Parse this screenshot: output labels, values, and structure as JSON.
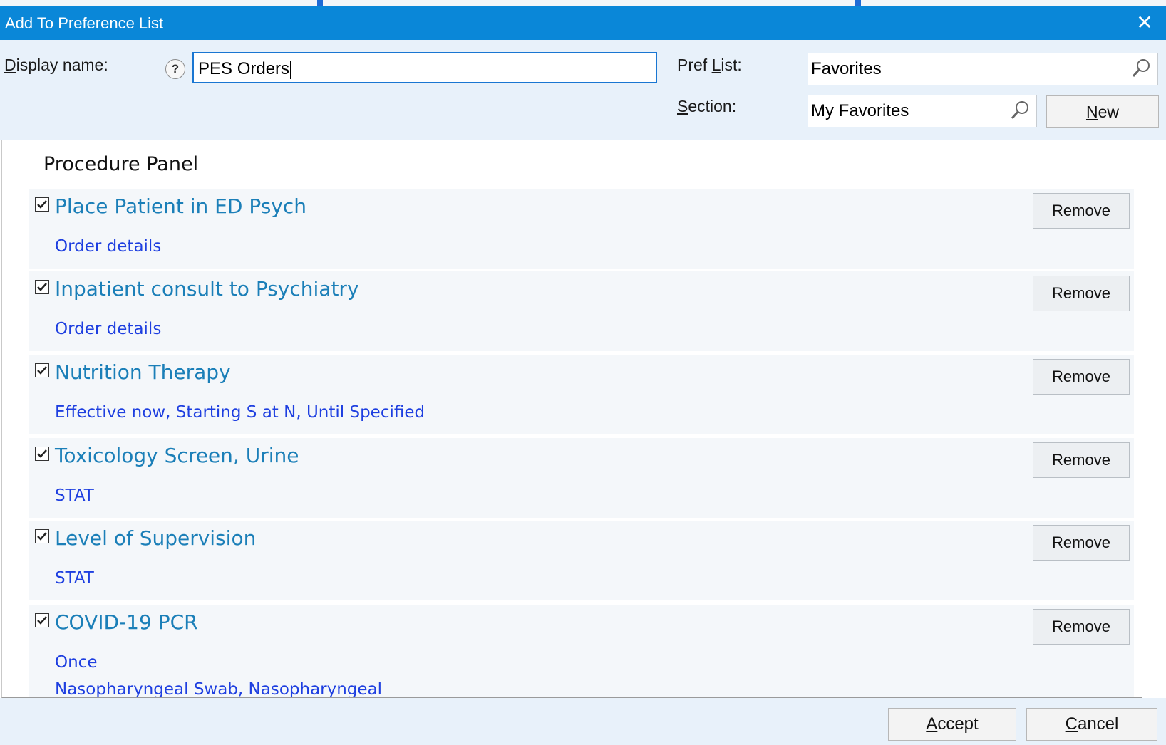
{
  "dialog": {
    "title": "Add To Preference List"
  },
  "header": {
    "display_name_label_pre": "D",
    "display_name_label_post": "isplay name:",
    "display_name_value": "PES Orders",
    "help_glyph": "?",
    "pref_list_label_pre": "Pref ",
    "pref_list_label_u": "L",
    "pref_list_label_post": "ist:",
    "pref_list_value": "Favorites",
    "section_label_u": "S",
    "section_label_post": "ection:",
    "section_value": "My Favorites",
    "new_button_u": "N",
    "new_button_post": "ew"
  },
  "list": {
    "heading": "Procedure Panel",
    "remove_label": "Remove",
    "items": [
      {
        "name": "Place Patient in ED Psych",
        "detail": "Order details",
        "checked": true
      },
      {
        "name": "Inpatient consult to Psychiatry",
        "detail": "Order details",
        "checked": true
      },
      {
        "name": "Nutrition Therapy",
        "detail": "Effective now, Starting S at N, Until Specified",
        "checked": true
      },
      {
        "name": "Toxicology Screen, Urine",
        "detail": "STAT",
        "checked": true
      },
      {
        "name": "Level of Supervision",
        "detail": "STAT",
        "checked": true
      },
      {
        "name": "COVID-19 PCR",
        "detail": "Once",
        "detail2": "Nasopharyngeal Swab, Nasopharyngeal",
        "checked": true
      }
    ]
  },
  "footer": {
    "accept_u": "A",
    "accept_post": "ccept",
    "cancel_u": "C",
    "cancel_post": "ancel"
  },
  "colors": {
    "titlebar": "#0a87d8",
    "item_name": "#1b7fb8",
    "item_detail": "#1e3fe0",
    "header_bg": "#e8f1fa"
  },
  "icons": {
    "close": "close-icon",
    "help": "help-icon",
    "search": "magnifier-icon",
    "checkbox": "checkmark-icon",
    "scroll_up": "chevron-up-icon",
    "scroll_down": "chevron-down-icon"
  }
}
